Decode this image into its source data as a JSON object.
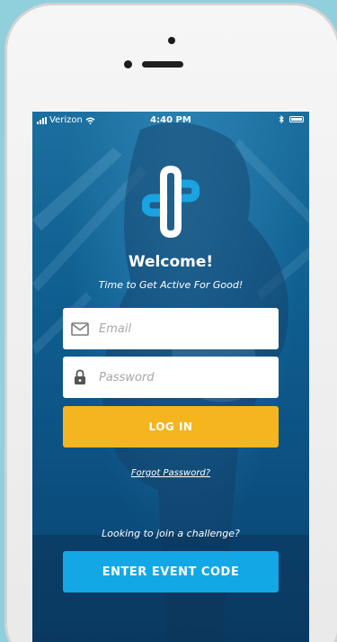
{
  "status_bar": {
    "carrier": "Verizon",
    "time": "4:40 PM"
  },
  "login": {
    "welcome": "Welcome!",
    "tagline": "Time to Get Active For Good!",
    "email_placeholder": "Email",
    "password_placeholder": "Password",
    "login_label": "LOG IN",
    "forgot_label": "Forgot Password?",
    "join_prompt": "Looking to join a challenge?",
    "event_code_label": "ENTER EVENT CODE"
  },
  "icons": {
    "signal": "signal-bars-icon",
    "wifi": "wifi-icon",
    "bluetooth": "bluetooth-icon",
    "battery": "battery-icon",
    "logo": "plus-logo-icon",
    "email": "envelope-icon",
    "password": "padlock-icon"
  },
  "colors": {
    "background": "#8fd0dc",
    "screen": "#0b5d8f",
    "login_button": "#f5b51e",
    "event_button": "#14a7e6",
    "logo_white": "#ffffff",
    "logo_blue": "#1aa3e0"
  }
}
